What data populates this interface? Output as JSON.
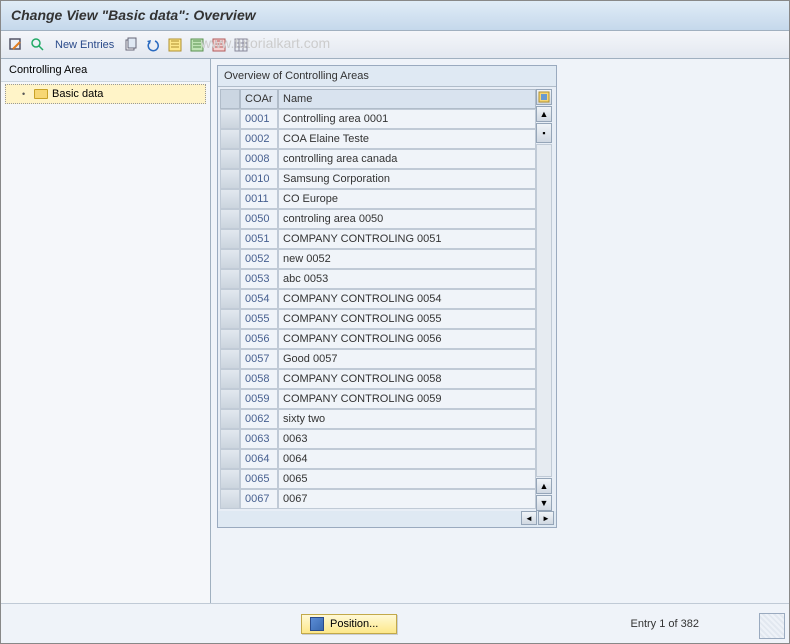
{
  "title": "Change View \"Basic data\": Overview",
  "watermark": "www.tutorialkart.com",
  "toolbar": {
    "new_entries": "New Entries"
  },
  "nav": {
    "header": "Controlling Area",
    "item": "Basic data"
  },
  "grid": {
    "title": "Overview of Controlling Areas",
    "col_coar": "COAr",
    "col_name": "Name",
    "rows": [
      {
        "coar": "0001",
        "name": "Controlling area 0001"
      },
      {
        "coar": "0002",
        "name": "COA Elaine Teste"
      },
      {
        "coar": "0008",
        "name": "controlling area canada"
      },
      {
        "coar": "0010",
        "name": "Samsung Corporation"
      },
      {
        "coar": "0011",
        "name": "CO Europe"
      },
      {
        "coar": "0050",
        "name": "controling area 0050"
      },
      {
        "coar": "0051",
        "name": "COMPANY CONTROLING 0051"
      },
      {
        "coar": "0052",
        "name": "new 0052"
      },
      {
        "coar": "0053",
        "name": "abc 0053"
      },
      {
        "coar": "0054",
        "name": "COMPANY CONTROLING 0054"
      },
      {
        "coar": "0055",
        "name": "COMPANY CONTROLING 0055"
      },
      {
        "coar": "0056",
        "name": "COMPANY CONTROLING 0056"
      },
      {
        "coar": "0057",
        "name": "Good 0057"
      },
      {
        "coar": "0058",
        "name": "COMPANY CONTROLING 0058"
      },
      {
        "coar": "0059",
        "name": "COMPANY CONTROLING 0059"
      },
      {
        "coar": "0062",
        "name": "sixty two"
      },
      {
        "coar": "0063",
        "name": "0063"
      },
      {
        "coar": "0064",
        "name": "0064"
      },
      {
        "coar": "0065",
        "name": "0065"
      },
      {
        "coar": "0067",
        "name": "0067"
      }
    ]
  },
  "footer": {
    "position_label": "Position...",
    "entry_text": "Entry 1 of 382"
  }
}
